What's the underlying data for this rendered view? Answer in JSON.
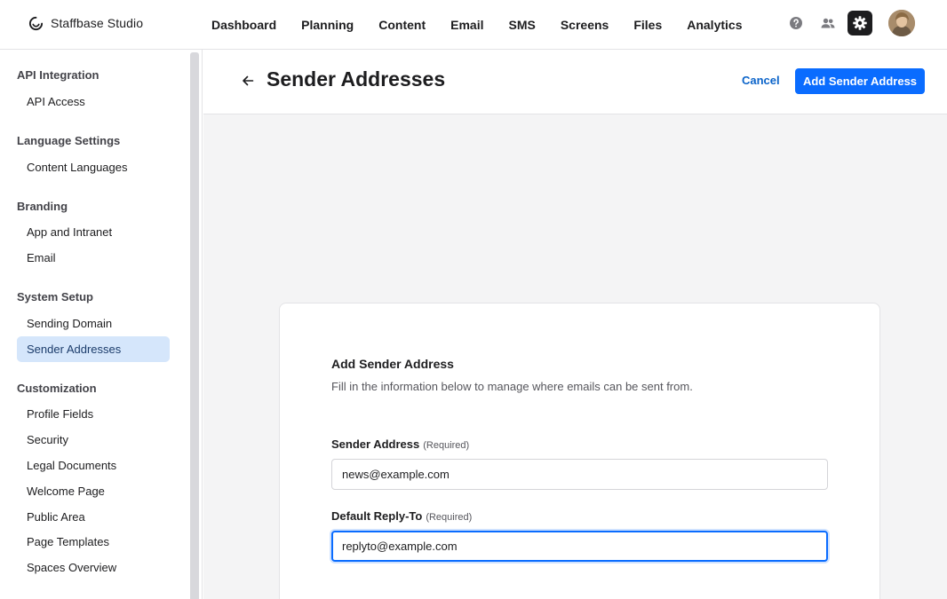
{
  "app": {
    "name": "Staffbase Studio"
  },
  "nav": [
    "Dashboard",
    "Planning",
    "Content",
    "Email",
    "SMS",
    "Screens",
    "Files",
    "Analytics"
  ],
  "top_actions": {
    "help": "help-icon",
    "users": "users-icon",
    "settings": "gear-icon"
  },
  "sidebar": {
    "sections": [
      {
        "title": "API Integration",
        "items": [
          "API Access"
        ]
      },
      {
        "title": "Language Settings",
        "items": [
          "Content Languages"
        ]
      },
      {
        "title": "Branding",
        "items": [
          "App and Intranet",
          "Email"
        ]
      },
      {
        "title": "System Setup",
        "items": [
          "Sending Domain",
          "Sender Addresses"
        ]
      },
      {
        "title": "Customization",
        "items": [
          "Profile Fields",
          "Security",
          "Legal Documents",
          "Welcome Page",
          "Public Area",
          "Page Templates",
          "Spaces Overview"
        ]
      }
    ],
    "active_item": "Sender Addresses"
  },
  "header": {
    "title": "Sender Addresses",
    "cancel_label": "Cancel",
    "primary_label": "Add Sender Address"
  },
  "form": {
    "title": "Add Sender Address",
    "description": "Fill in the information below to manage where emails can be sent from.",
    "sender_label": "Sender Address",
    "sender_required": "(Required)",
    "sender_value": "news@example.com",
    "reply_label": "Default Reply-To",
    "reply_required": "(Required)",
    "reply_value": "replyto@example.com"
  },
  "colors": {
    "accent": "#0a6cff",
    "link": "#0a63c9",
    "active_bg": "#d5e6fb"
  }
}
